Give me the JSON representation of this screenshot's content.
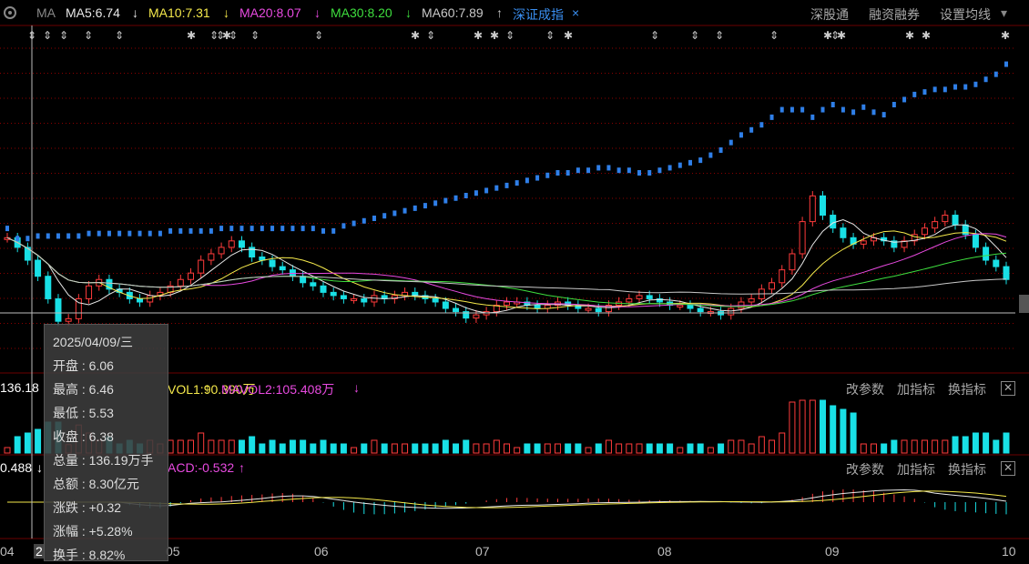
{
  "header": {
    "ma_label": "MA",
    "items": [
      {
        "text": "MA5:6.74",
        "arrow": "↓",
        "color": "#e8e8e8"
      },
      {
        "text": "MA10:7.31",
        "arrow": "↓",
        "color": "#f5e94b"
      },
      {
        "text": "MA20:8.07",
        "arrow": "↓",
        "color": "#e84ae0"
      },
      {
        "text": "MA30:8.20",
        "arrow": "↓",
        "color": "#3ede3e"
      },
      {
        "text": "MA60:7.89",
        "arrow": "↑",
        "color": "#c8c8c8"
      }
    ],
    "index_name": "深证成指",
    "index_close": "×",
    "buttons": [
      "深股通",
      "融资融券",
      "设置均线"
    ]
  },
  "volume_panel": {
    "left_value": "136.18",
    "mavol1": "VOL1:90.390万",
    "mavol1_arrow": "↑",
    "mavol2": "MAVOL2:105.408万",
    "mavol2_arrow": "↓",
    "buttons": [
      "改参数",
      "加指标",
      "换指标"
    ]
  },
  "macd_panel": {
    "left_value": "0.488",
    "left_arrow": "↓",
    "macd": "ACD:-0.532",
    "macd_arrow": "↑",
    "buttons": [
      "改参数",
      "加指标",
      "换指标"
    ]
  },
  "tooltip": {
    "date": "2025/04/09/三",
    "rows": [
      "开盘 : 6.06",
      "最高 : 6.46",
      "最低 : 5.53",
      "收盘 : 6.38",
      "总量 : 136.19万手",
      "总额 : 8.30亿元",
      "涨跌 : +0.32",
      "涨幅 : +5.28%",
      "换手 : 8.82%"
    ]
  },
  "x_axis_labels": [
    "04",
    "2",
    "05",
    "06",
    "07",
    "08",
    "09",
    "10"
  ],
  "chart_data": {
    "type": "candlestick",
    "note_series": "stock price with MA lines; index overlay in blue",
    "categories_months": [
      "04",
      "05",
      "06",
      "07",
      "08",
      "09",
      "10"
    ],
    "selected_bar": {
      "date": "2025/04/09",
      "open": 6.06,
      "high": 6.46,
      "low": 5.53,
      "close": 6.38
    },
    "ma": {
      "MA5": 6.74,
      "MA10": 7.31,
      "MA20": 8.07,
      "MA30": 8.2,
      "MA60": 7.89
    },
    "close_series": [
      8.9,
      8.6,
      8.2,
      7.7,
      7.0,
      6.3,
      6.38,
      7.0,
      7.4,
      7.6,
      7.3,
      7.2,
      7.0,
      6.9,
      7.1,
      7.2,
      7.4,
      7.6,
      7.8,
      8.2,
      8.4,
      8.6,
      8.8,
      8.6,
      8.3,
      8.2,
      8.0,
      7.9,
      7.7,
      7.5,
      7.4,
      7.2,
      7.1,
      7.0,
      7.0,
      6.9,
      7.1,
      7.0,
      7.1,
      7.2,
      7.1,
      7.0,
      6.9,
      6.7,
      6.6,
      6.4,
      6.5,
      6.6,
      6.8,
      6.9,
      6.9,
      6.8,
      6.7,
      6.8,
      6.9,
      6.8,
      6.7,
      6.7,
      6.6,
      6.8,
      6.9,
      7.0,
      7.1,
      7.0,
      6.9,
      6.8,
      6.8,
      6.7,
      6.6,
      6.6,
      6.5,
      6.7,
      6.9,
      7.0,
      7.3,
      7.5,
      7.9,
      8.4,
      9.4,
      10.2,
      9.6,
      9.2,
      8.9,
      8.7,
      8.8,
      8.9,
      8.8,
      8.6,
      8.8,
      9.0,
      9.2,
      9.4,
      9.6,
      9.3,
      9.0,
      8.6,
      8.2,
      8.0,
      7.6
    ],
    "index_series": [
      8.9,
      8.5,
      8.5,
      8.6,
      8.6,
      8.6,
      8.6,
      8.6,
      8.7,
      8.7,
      8.7,
      8.7,
      8.7,
      8.7,
      8.7,
      8.7,
      8.8,
      8.8,
      8.8,
      8.8,
      8.8,
      8.9,
      8.9,
      8.9,
      8.9,
      8.9,
      8.9,
      8.9,
      8.9,
      8.9,
      8.9,
      8.8,
      8.8,
      9.0,
      9.1,
      9.2,
      9.3,
      9.4,
      9.5,
      9.6,
      9.7,
      9.8,
      9.9,
      10.0,
      10.1,
      10.2,
      10.3,
      10.4,
      10.5,
      10.6,
      10.7,
      10.8,
      10.9,
      11.0,
      11.1,
      11.1,
      11.2,
      11.2,
      11.3,
      11.3,
      11.2,
      11.2,
      11.1,
      11.1,
      11.2,
      11.3,
      11.4,
      11.5,
      11.6,
      11.8,
      12.0,
      12.3,
      12.6,
      12.8,
      13.0,
      13.3,
      13.6,
      13.6,
      13.6,
      13.3,
      13.6,
      13.8,
      13.6,
      13.5,
      13.7,
      13.5,
      13.4,
      13.8,
      14.0,
      14.2,
      14.3,
      14.4,
      14.4,
      14.5,
      14.5,
      14.6,
      14.8,
      15.0,
      15.4
    ]
  }
}
